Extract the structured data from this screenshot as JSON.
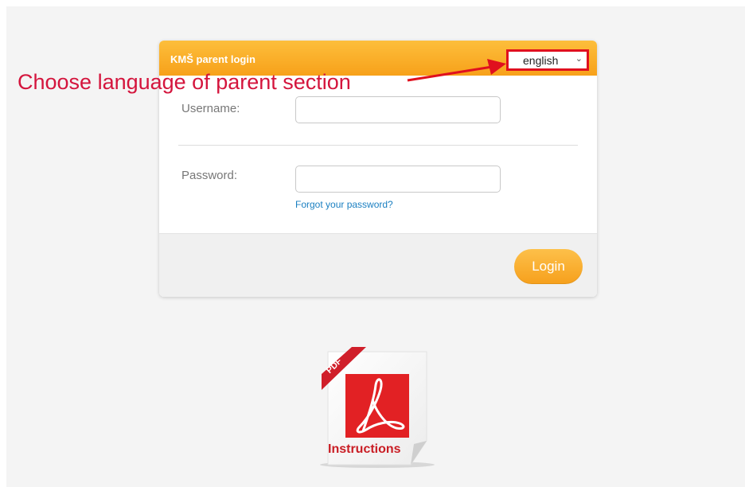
{
  "login": {
    "title": "KMŠ parent login",
    "language": {
      "selected": "english",
      "chevron_icon": "chevron-down-icon"
    },
    "username_label": "Username:",
    "password_label": "Password:",
    "username_value": "",
    "password_value": "",
    "forgot_link": "Forgot your password?",
    "login_button": "Login"
  },
  "annotation": {
    "text": "Choose language of parent section",
    "color": "#d4153d"
  },
  "instructions": {
    "badge": "PDF",
    "caption": "Instructions",
    "icon": "pdf-document-icon"
  },
  "colors": {
    "accent_orange": "#f7a11a",
    "highlight_red": "#e0101e",
    "link_blue": "#1a7fc1"
  }
}
